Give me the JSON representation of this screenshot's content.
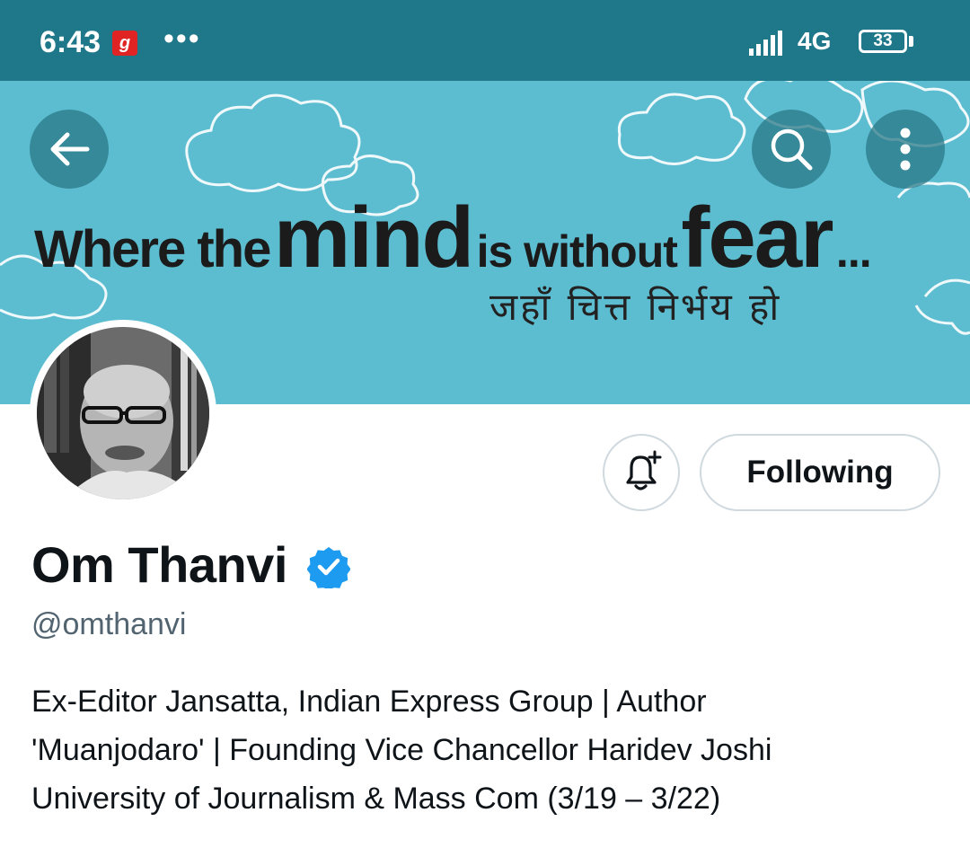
{
  "status_bar": {
    "time": "6:43",
    "app_badge": "g",
    "overflow": "•••",
    "network": "4G",
    "battery": "33"
  },
  "banner": {
    "line_part1": "Where the",
    "line_part2": "mind",
    "line_part3": "is without",
    "line_part4": "fear",
    "line_part5": "...",
    "hindi_line": "जहाँ चित्त निर्भय हो",
    "background_color": "#5dbdd0"
  },
  "toolbar": {
    "back_icon": "arrow-left-icon",
    "search_icon": "search-icon",
    "more_icon": "more-vertical-icon"
  },
  "actions": {
    "notify_icon": "bell-plus-icon",
    "follow_label": "Following"
  },
  "profile": {
    "display_name": "Om Thanvi",
    "verified_icon": "verified-badge-icon",
    "verified_color": "#1d9bf0",
    "handle": "@omthanvi",
    "bio_lines": [
      "Ex-Editor Jansatta, Indian Express Group | Author",
      "'Muanjodaro' | Founding Vice Chancellor Haridev Joshi",
      "University of Journalism & Mass Com (3/19 – 3/22)"
    ]
  }
}
